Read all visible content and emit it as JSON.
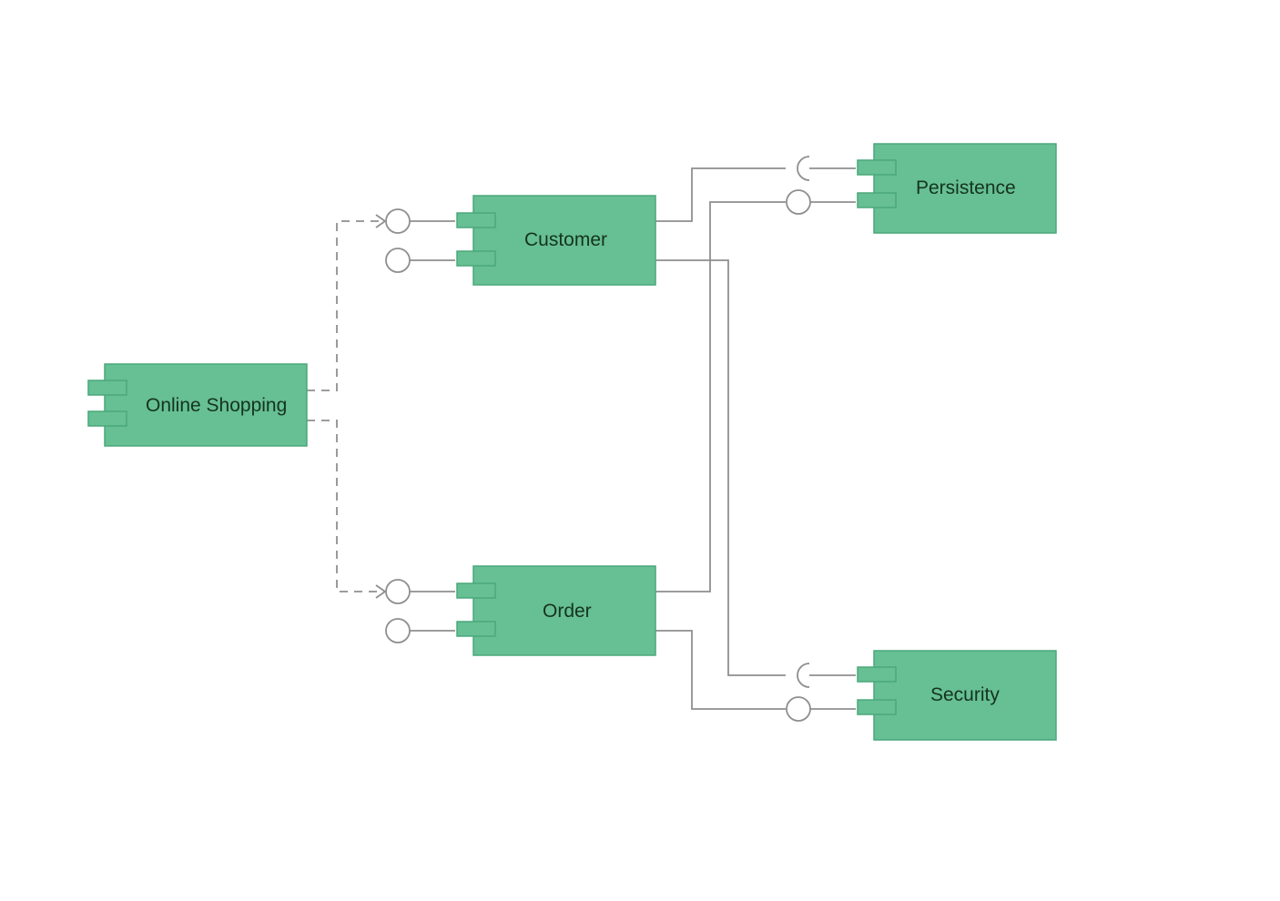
{
  "diagram": {
    "type": "UML Component Diagram",
    "components": {
      "online_shopping": {
        "label": "Online Shopping"
      },
      "customer": {
        "label": "Customer"
      },
      "order": {
        "label": "Order"
      },
      "persistence": {
        "label": "Persistence"
      },
      "security": {
        "label": "Security"
      }
    },
    "connections": [
      {
        "from": "online_shopping",
        "to": "customer",
        "style": "dashed-dependency"
      },
      {
        "from": "online_shopping",
        "to": "order",
        "style": "dashed-dependency"
      },
      {
        "from": "customer",
        "to": "persistence",
        "style": "solid"
      },
      {
        "from": "customer",
        "to": "security",
        "style": "solid"
      },
      {
        "from": "order",
        "to": "persistence",
        "style": "solid"
      },
      {
        "from": "order",
        "to": "security",
        "style": "solid"
      }
    ]
  }
}
